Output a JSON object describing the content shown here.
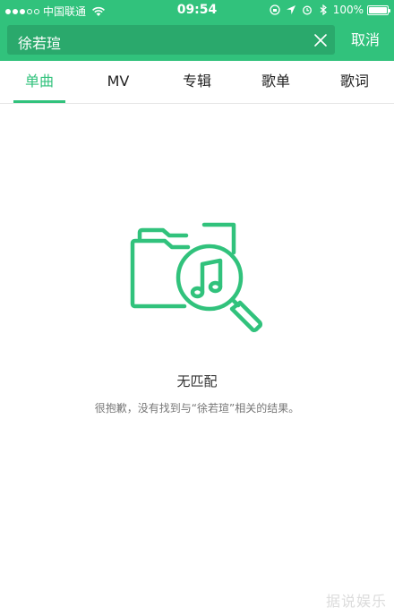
{
  "status_bar": {
    "carrier": "中国联通",
    "time": "09:54",
    "battery": "100%",
    "battery_level": 1.0
  },
  "search": {
    "value": "徐若瑄",
    "cancel_label": "取消"
  },
  "tabs": [
    {
      "label": "单曲",
      "active": true
    },
    {
      "label": "MV",
      "active": false
    },
    {
      "label": "专辑",
      "active": false
    },
    {
      "label": "歌单",
      "active": false
    },
    {
      "label": "歌词",
      "active": false
    }
  ],
  "empty_state": {
    "title": "无匹配",
    "message": "很抱歉，没有找到与“徐若瑄”相关的结果。",
    "icon": "folder-music-search-icon"
  },
  "watermark": "据说娱乐",
  "colors": {
    "accent": "#31c27c",
    "search_bg": "#2aa96c"
  }
}
